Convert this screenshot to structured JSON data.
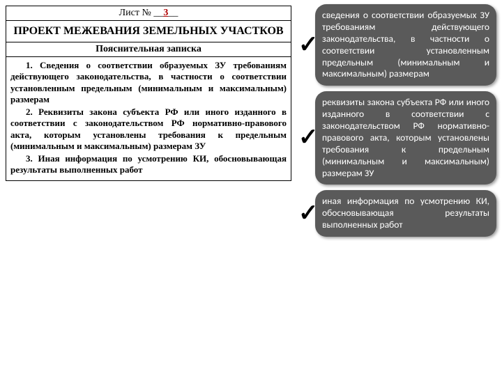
{
  "left": {
    "sheet_label": "Лист № __",
    "sheet_number": "3",
    "sheet_after": "__",
    "title": "ПРОЕКТ МЕЖЕВАНИЯ ЗЕМЕЛЬНЫХ УЧАСТКОВ",
    "subtitle": "Пояснительная записка",
    "p1": "1.  Сведения о соответствии образуемых ЗУ требованиям действующего законодательства, в частности о соответствии установленным предельным (минимальным и максимальным) размерам",
    "p2": "2. Реквизиты закона субъекта РФ или иного изданного в соответствии с законодательством РФ нормативно-правового акта, которым установлены требования к предельным (минимальным и максимальным) размерам ЗУ",
    "p3": "3.  Иная информация по усмотрению КИ, обосновывающая результаты выполненных работ"
  },
  "callouts": [
    "сведения о соответствии образуемых ЗУ требованиям действующего законодательства, в частности о соответствии установленным предельным (минимальным и максимальным) размерам",
    "реквизиты закона субъекта РФ или иного изданного в соответствии с законодательством РФ нормативно-правового акта, которым установлены требования к предельным (минимальным и максимальным) размерам ЗУ",
    "иная информация по усмотрению КИ, обосновывающая результаты выполненных работ"
  ]
}
